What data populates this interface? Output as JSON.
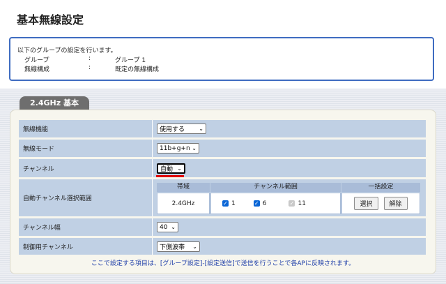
{
  "page": {
    "title": "基本無線設定"
  },
  "info": {
    "description": "以下のグループの設定を行います。",
    "rows": [
      {
        "key": "グループ",
        "colon": ":",
        "value": "グループ 1"
      },
      {
        "key": "無線構成",
        "colon": ":",
        "value": "既定の無線構成"
      }
    ]
  },
  "tab": {
    "label": "2.4GHz 基本"
  },
  "form": {
    "wireless_function": {
      "label": "無線機能",
      "value": "使用する"
    },
    "wireless_mode": {
      "label": "無線モード",
      "value": "11b+g+n"
    },
    "channel": {
      "label": "チャンネル",
      "value": "自動"
    },
    "auto_range": {
      "label": "自動チャンネル選択範囲",
      "headers": {
        "band": "帯域",
        "range": "チャンネル範囲",
        "bulk": "一括設定"
      },
      "band_value": "2.4GHz",
      "channels": [
        {
          "label": "1",
          "checked": true,
          "disabled": false
        },
        {
          "label": "6",
          "checked": true,
          "disabled": false
        },
        {
          "label": "11",
          "checked": true,
          "disabled": true
        }
      ],
      "buttons": {
        "select": "選択",
        "clear": "解除"
      }
    },
    "channel_width": {
      "label": "チャンネル幅",
      "value": "40"
    },
    "control_channel": {
      "label": "制御用チャンネル",
      "value": "下側波帯"
    }
  },
  "note": "ここで設定する項目は、[グループ設定]-[設定送信]で送信を行うことで各APに反映されます。",
  "colors": {
    "accent": "#3f6cc1",
    "row_bg": "#c0d0e4",
    "header_bg": "#a9bcd8",
    "underline": "#e00000",
    "note": "#1d3da8"
  },
  "icons": {
    "dropdown": "chevron-down-icon",
    "checkbox": "checkmark-icon"
  }
}
